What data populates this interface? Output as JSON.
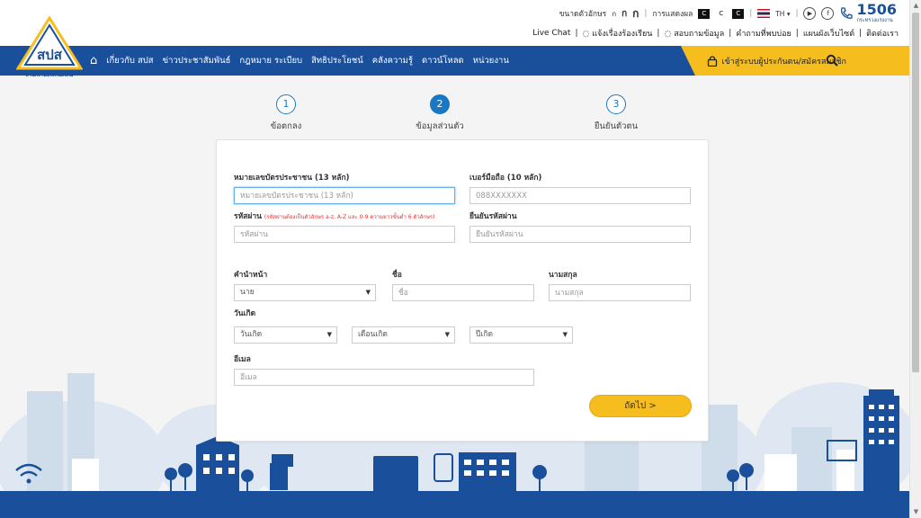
{
  "header": {
    "font_size_label": "ขนาดตัวอักษร",
    "font_sizes": [
      "ก",
      "ก",
      "ก"
    ],
    "display_label": "การแสดงผล",
    "contrast": [
      "C",
      "C",
      "C"
    ],
    "lang": "TH",
    "hotline": {
      "number": "1506",
      "sub": "กระทรวงแรงงาน"
    },
    "links": [
      "Live Chat",
      "แจ้งเรื่องร้องเรียน",
      "สอบถามข้อมูล",
      "คำถามที่พบบ่อย",
      "แผนผังเว็บไซต์",
      "ติดต่อเรา"
    ]
  },
  "logo": {
    "caption": "สำนักงานประกันสังคม",
    "mark": "สปส"
  },
  "nav": {
    "items": [
      "เกี่ยวกับ สปส",
      "ข่าวประชาสัมพันธ์",
      "กฎหมาย ระเบียบ",
      "สิทธิประโยชน์",
      "คลังความรู้",
      "ดาวน์โหลด",
      "หน่วยงาน"
    ],
    "login": "เข้าสู่ระบบผู้ประกันตน/สมัครสมาชิก"
  },
  "steps": [
    {
      "num": "1",
      "label": "ข้อตกลง"
    },
    {
      "num": "2",
      "label": "ข้อมูลส่วนตัว"
    },
    {
      "num": "3",
      "label": "ยืนยันตัวตน"
    }
  ],
  "form": {
    "id_label": "หมายเลขบัตรประชาชน (13 หลัก)",
    "id_placeholder": "หมายเลขบัตรประชาชน (13 หลัก)",
    "phone_label": "เบอร์มือถือ (10 หลัก)",
    "phone_placeholder": "088XXXXXXX",
    "password_label": "รหัสผ่าน",
    "password_hint": "(รหัสผ่านต้องเป็นตัวอักษร a-z, A-Z และ 0-9 ความยาวขั้นต่ำ 6 ตัวอักษร)",
    "password_placeholder": "รหัสผ่าน",
    "confirm_label": "ยืนยันรหัสผ่าน",
    "confirm_placeholder": "ยืนยันรหัสผ่าน",
    "title_label": "คำนำหน้า",
    "title_value": "นาย",
    "firstname_label": "ชื่อ",
    "firstname_placeholder": "ชื่อ",
    "lastname_label": "นามสกุล",
    "lastname_placeholder": "นามสกุล",
    "birthdate_label": "วันเกิด",
    "day_value": "วันเกิด",
    "month_value": "เดือนเกิด",
    "year_value": "ปีเกิด",
    "email_label": "อีเมล",
    "email_placeholder": "อีเมล",
    "next_label": "ถัดไป >"
  },
  "colors": {
    "primary": "#1a4f9c",
    "accent": "#f5be1e",
    "step": "#1a78c2"
  }
}
